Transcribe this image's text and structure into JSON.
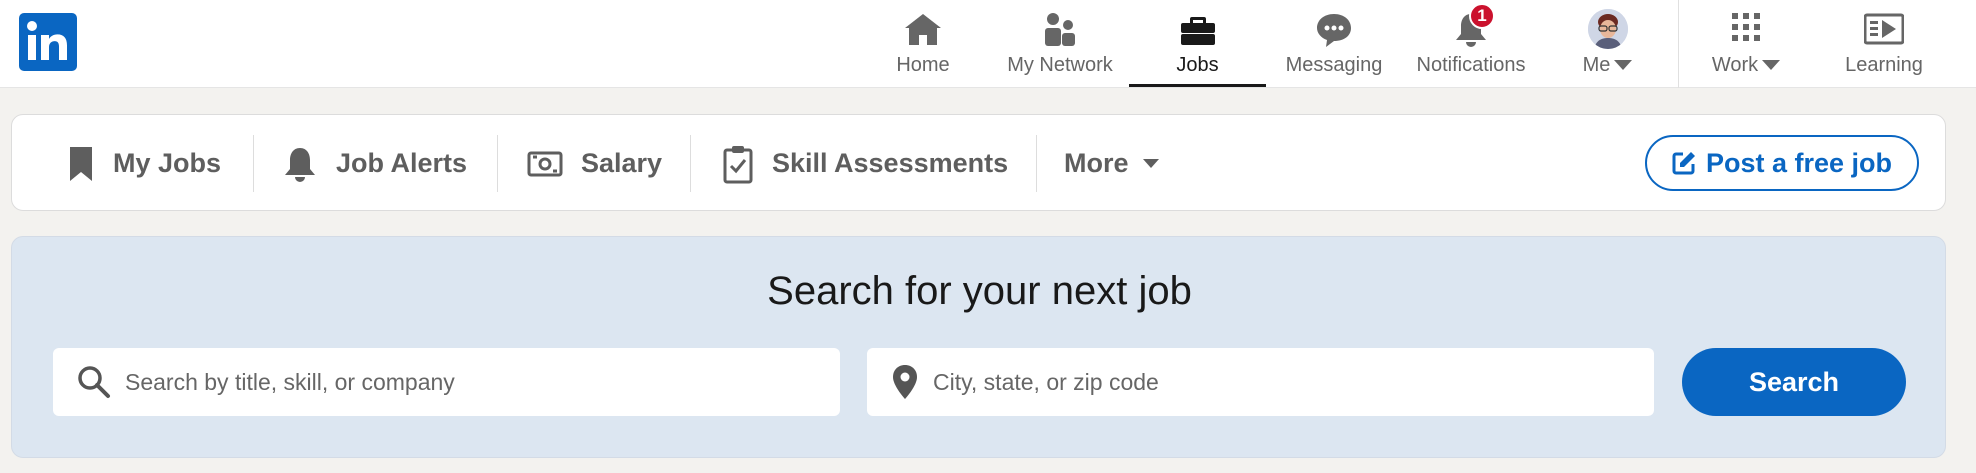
{
  "brand": {
    "logo_text": "in",
    "color": "#0a66c2"
  },
  "topnav": {
    "items": [
      {
        "label": "Home",
        "icon": "home-icon"
      },
      {
        "label": "My Network",
        "icon": "network-icon"
      },
      {
        "label": "Jobs",
        "icon": "briefcase-icon",
        "active": true
      },
      {
        "label": "Messaging",
        "icon": "messaging-icon"
      },
      {
        "label": "Notifications",
        "icon": "bell-icon",
        "badge": "1"
      },
      {
        "label": "Me",
        "icon": "avatar",
        "dropdown": true
      },
      {
        "label": "Work",
        "icon": "grid-icon",
        "dropdown": true
      },
      {
        "label": "Learning",
        "icon": "learning-icon"
      }
    ]
  },
  "subnav": {
    "items": [
      {
        "label": "My Jobs",
        "icon": "bookmark-icon"
      },
      {
        "label": "Job Alerts",
        "icon": "bell-icon"
      },
      {
        "label": "Salary",
        "icon": "money-icon"
      },
      {
        "label": "Skill Assessments",
        "icon": "clipboard-check-icon"
      },
      {
        "label": "More",
        "icon": "chevron-down-icon"
      }
    ],
    "post_job_label": "Post a free job"
  },
  "search": {
    "title": "Search for your next job",
    "keyword_placeholder": "Search by title, skill, or company",
    "location_placeholder": "City, state, or zip code",
    "button_label": "Search"
  },
  "colors": {
    "accent": "#0a66c2",
    "badge": "#cb112d",
    "search_card_bg": "#dce6f1",
    "page_bg": "#f3f2ef"
  }
}
